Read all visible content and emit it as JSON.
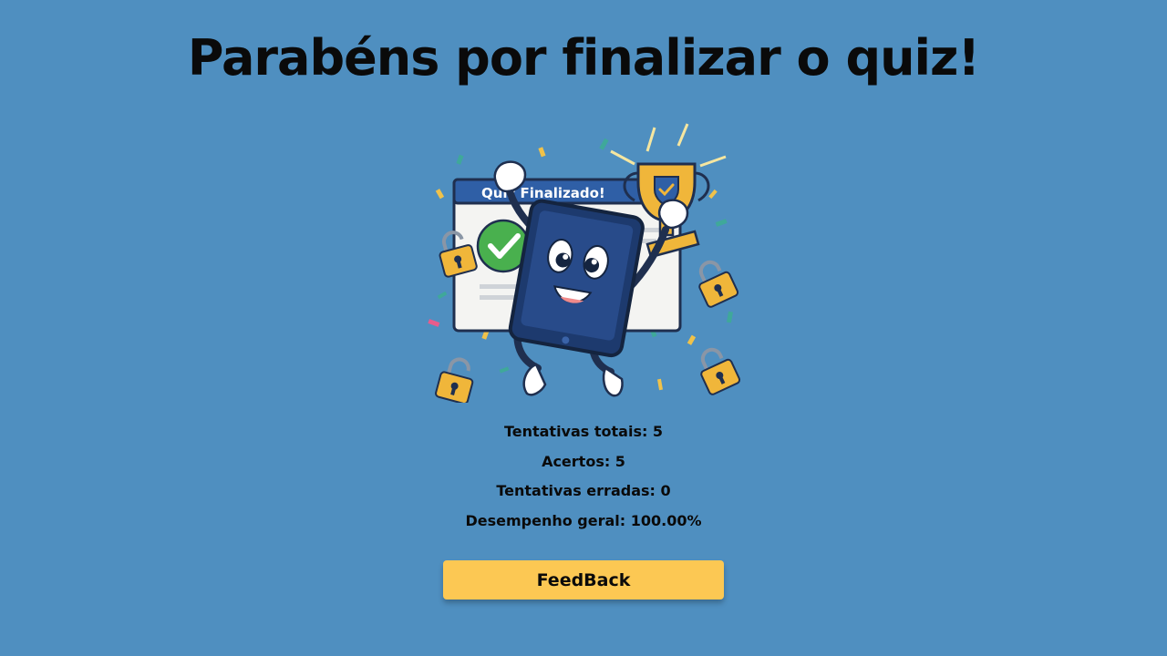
{
  "heading": "Parabéns por finalizar o quiz!",
  "illustration": {
    "banner_text": "Quiz Finalizado!",
    "icons": [
      "celebrating-tablet-icon",
      "trophy-icon",
      "check-icon",
      "unlocked-padlock-icon",
      "confetti-icon"
    ]
  },
  "stats": {
    "total_attempts": "Tentativas totais: 5",
    "correct": "Acertos: 5",
    "wrong_attempts": "Tentativas erradas: 0",
    "overall_performance": "Desempenho geral: 100.00%"
  },
  "feedback_button": "FeedBack",
  "colors": {
    "background": "#4f8fc0",
    "button": "#fcc853",
    "text": "#0a0a0a"
  }
}
